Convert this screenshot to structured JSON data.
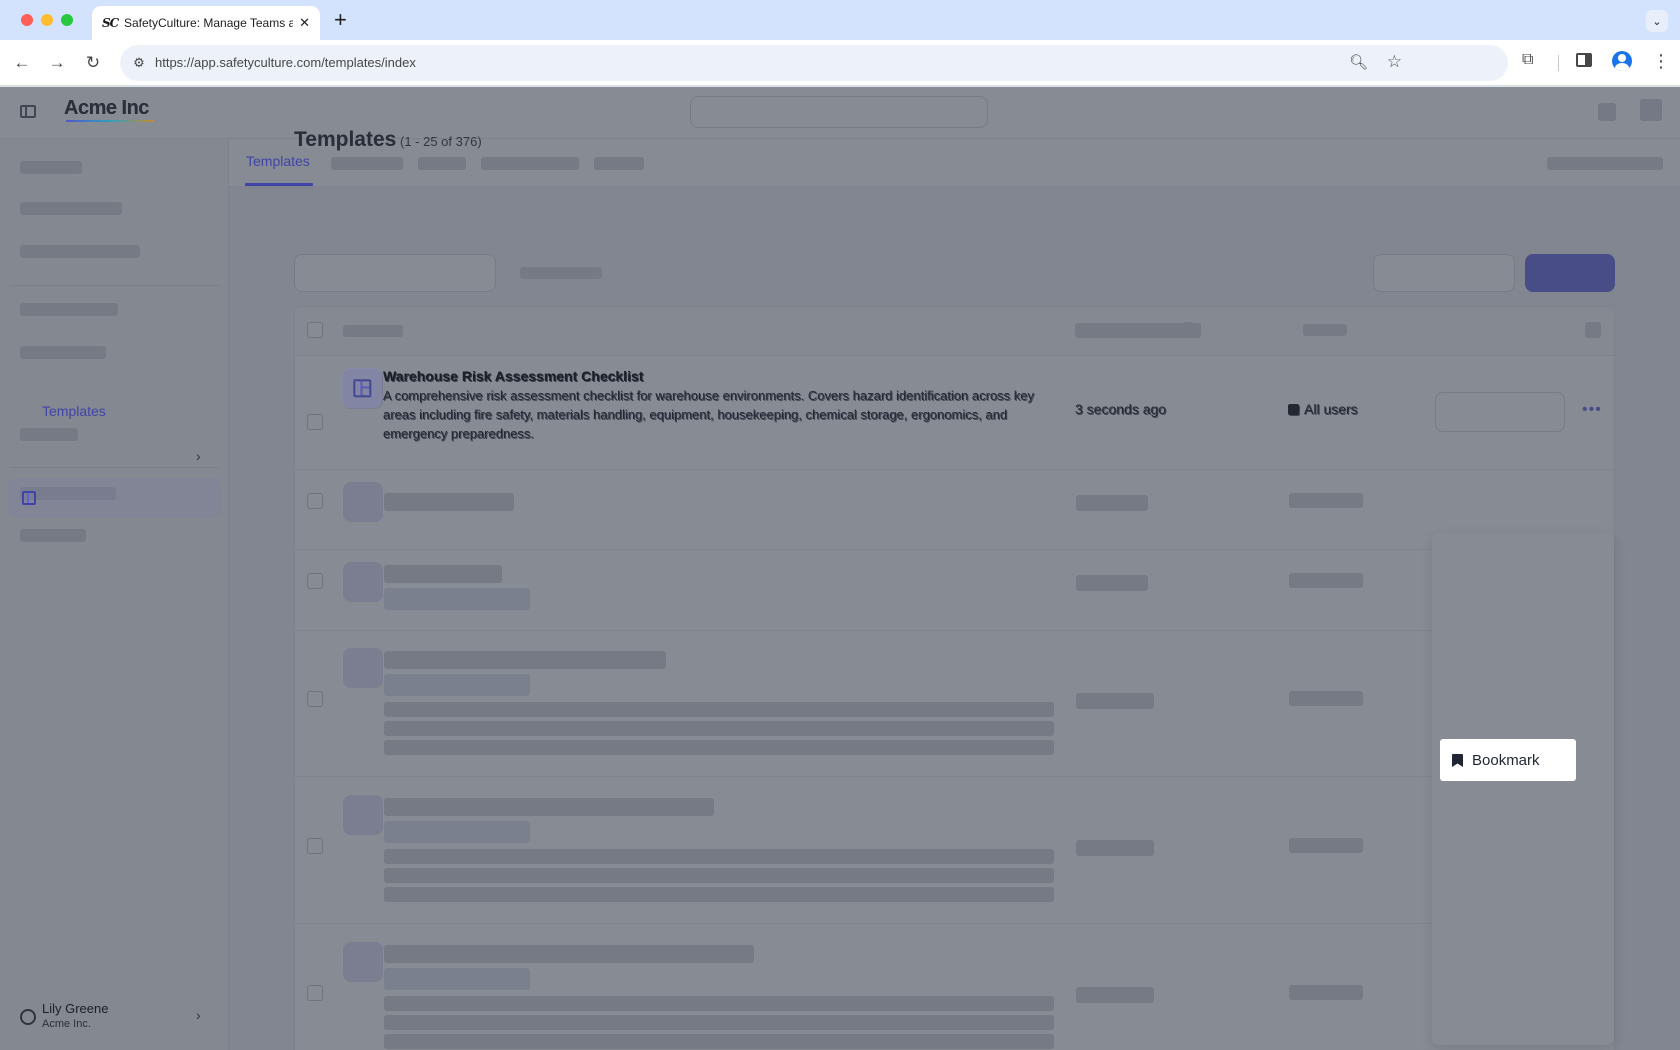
{
  "browser": {
    "tab": {
      "favicon_text": "SC",
      "title": "SafetyCulture: Manage Teams and...",
      "close_glyph": "✕"
    },
    "new_tab_glyph": "+",
    "tab_menu_glyph": "⌄",
    "nav": {
      "back": "←",
      "forward": "→",
      "reload": "↻"
    },
    "address": {
      "url": "https://app.safetyculture.com/templates/index",
      "site_info_icon": "tune-icon",
      "zoom_icon": "zoom-icon",
      "bookmark_icon": "star-icon"
    },
    "more_glyph": "⋮"
  },
  "app": {
    "logo": "Acme Inc",
    "sidebar": {
      "active_item": "Templates",
      "user": {
        "name": "Lily Greene",
        "org": "Acme Inc."
      }
    },
    "tabs": {
      "active": "Templates"
    },
    "page": {
      "title": "Templates",
      "count": "(1 - 25 of 376)"
    },
    "table": {
      "rows": [
        {
          "title": "Warehouse Risk Assessment Checklist",
          "description": "A comprehensive risk assessment checklist for warehouse environments. Covers hazard identification across key areas including fire safety, materials handling, equipment, housekeeping, chemical storage, ergonomics, and emergency preparedness.",
          "last_modified": "3 seconds ago",
          "access": "All users"
        }
      ],
      "more_glyph": "•••"
    }
  },
  "context_menu": {
    "highlighted_item": {
      "label": "Bookmark",
      "icon": "bookmark-icon"
    }
  },
  "colors": {
    "accent": "#5254e0",
    "overlay": "rgba(67,73,86,0.64)"
  }
}
